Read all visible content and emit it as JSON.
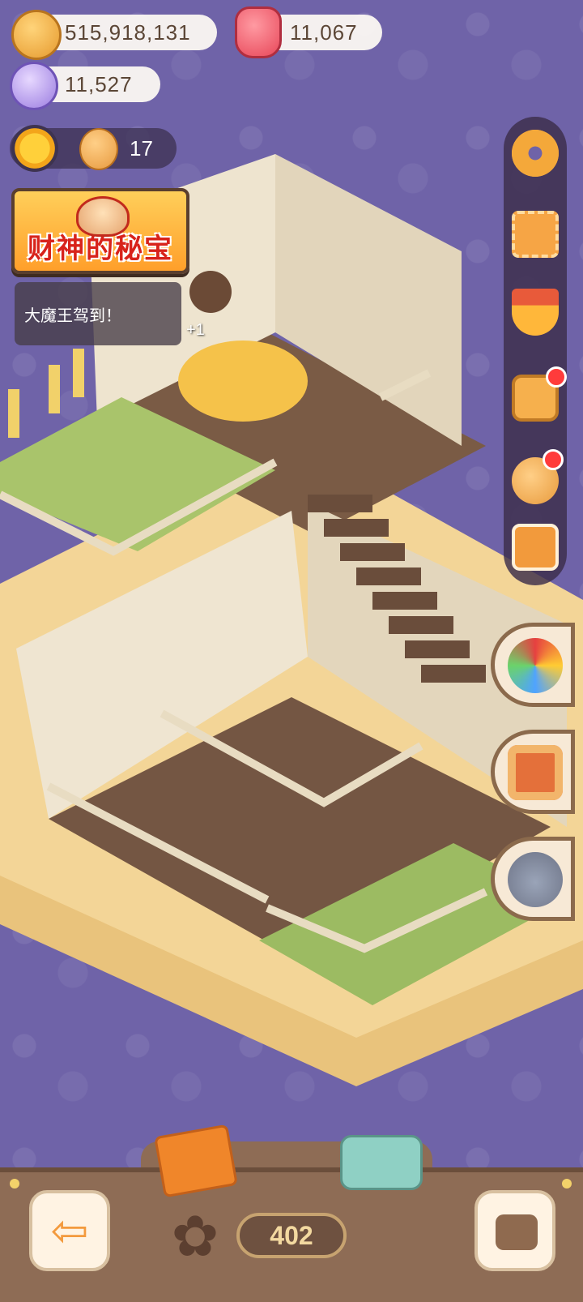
{
  "currencies": {
    "coins": "515,918,131",
    "jelly": "11,067",
    "crystals": "11,527"
  },
  "level": {
    "value": "17"
  },
  "event_banner": {
    "title": "财神的秘宝"
  },
  "notice": {
    "text": "大魔王驾到！"
  },
  "scene": {
    "float_text": "+1"
  },
  "bottom": {
    "count": "402",
    "back_arrow": "⇦",
    "star_glyph": "✿"
  },
  "icons": {
    "coin": "coin-icon",
    "jelly": "jelly-icon",
    "crystal": "crystal-icon",
    "sun": "sun-icon",
    "gear": "gear-icon",
    "camera": "camera-icon"
  },
  "colors": {
    "background": "#6f63a8",
    "accent": "#f4a83a",
    "bar": "#8e6c55"
  }
}
